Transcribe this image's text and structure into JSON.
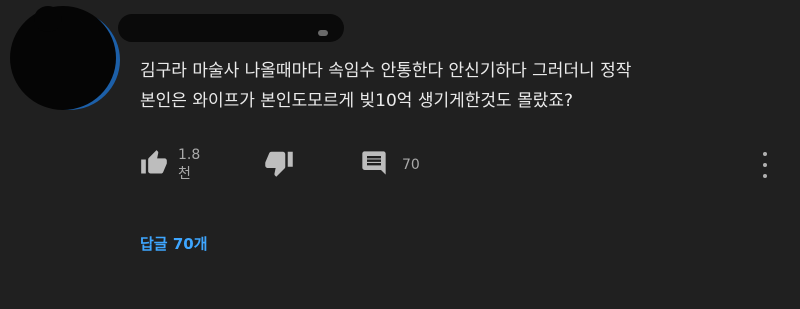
{
  "comment": {
    "lines": [
      "김구라 마술사 나올때마다 속임수 안통한다 안신기하다 그러더니 정작",
      "본인은 와이프가 본인도모르게 빚10억 생기게한것도 몰랐죠?"
    ]
  },
  "actions": {
    "like_count": "1.8천",
    "reply_count": "70"
  },
  "replies_link": "답글 70개",
  "colors": {
    "background": "#202020",
    "text": "#eaeaea",
    "muted": "#a9a9a9",
    "link": "#3ea6ff"
  },
  "icons": [
    "thumbs-up-icon",
    "thumbs-down-icon",
    "comment-icon",
    "more-vert-icon"
  ]
}
